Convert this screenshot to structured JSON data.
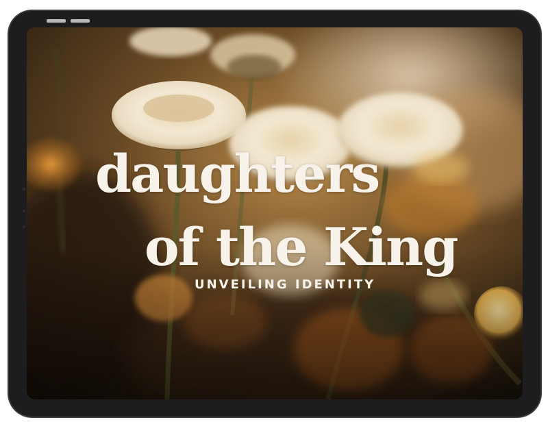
{
  "hero": {
    "title_line_1": "daughters",
    "title_line_2": "of the King",
    "subtitle": "UNVEILING IDENTITY"
  },
  "colors": {
    "device_frame": "#1d1d1f",
    "text": "#f7f2ea",
    "background_dark": "#3a2a18",
    "flower_cream": "#efe3cc",
    "accent_orange": "#d08a2e"
  }
}
